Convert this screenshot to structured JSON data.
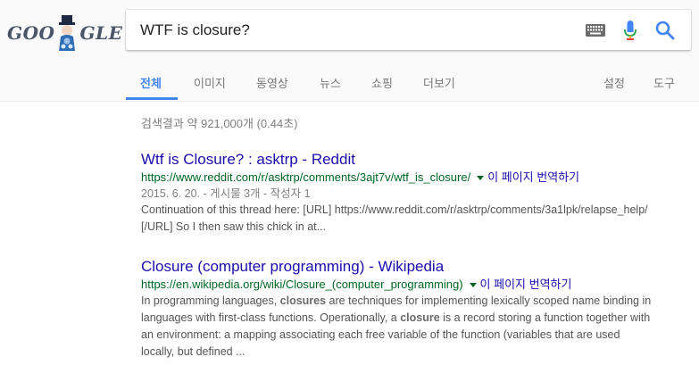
{
  "logo": {
    "text_left": "GOO",
    "text_right": "GLE"
  },
  "search": {
    "query": "WTF is closure?"
  },
  "tabs": [
    {
      "label": "전체",
      "active": true
    },
    {
      "label": "이미지"
    },
    {
      "label": "동영상"
    },
    {
      "label": "뉴스"
    },
    {
      "label": "쇼핑"
    },
    {
      "label": "더보기"
    },
    {
      "label": "설정"
    },
    {
      "label": "도구"
    }
  ],
  "stats": "검색결과 약 921,000개 (0.44초)",
  "results": [
    {
      "title": "Wtf is Closure? : asktrp - Reddit",
      "url": "https://www.reddit.com/r/asktrp/comments/3ajt7v/wtf_is_closure/",
      "translate": "이 페이지 번역하기",
      "meta": "2015. 6. 20. - 게시물 3개 - 작성자 1",
      "snippet_lines": [
        "Continuation of this thread here: [URL] https://www.reddit.com/r/asktrp/comments/3a1lpk/relapse_help/",
        "[/URL] So I then saw this chick in at..."
      ]
    },
    {
      "title": "Closure (computer programming) - Wikipedia",
      "url": "https://en.wikipedia.org/wiki/Closure_(computer_programming)",
      "translate": "이 페이지 번역하기",
      "snippet": {
        "l1a": "In programming languages, ",
        "l1b": "closures",
        "l1c": " are techniques for implementing lexically scoped name binding in",
        "l2a": "languages with first-class functions. Operationally, a ",
        "l2b": "closure",
        "l2c": " is a record storing a function together with",
        "l3": "an environment: a mapping associating each free variable of the function (variables that are used",
        "l4": "locally, but defined ..."
      }
    }
  ],
  "colors": {
    "link": "#1a0dab",
    "url": "#006621",
    "active_tab": "#4285f4"
  },
  "icons": [
    "keyboard-icon",
    "microphone-icon",
    "search-icon"
  ]
}
